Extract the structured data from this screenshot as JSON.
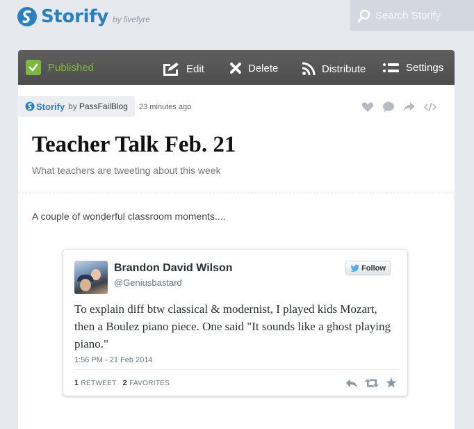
{
  "header": {
    "logo_text": "Storify",
    "logo_sub": "by livefyre",
    "search_placeholder": "Search Storify"
  },
  "toolbar": {
    "published_label": "Published",
    "edit_label": "Edit",
    "delete_label": "Delete",
    "distribute_label": "Distribute",
    "settings_label": "Settings"
  },
  "story": {
    "brand": "Storify",
    "by": "by",
    "author": "PassFailBlog",
    "time_ago": "23 minutes ago",
    "title": "Teacher Talk Feb. 21",
    "subtitle": "What teachers are tweeting about this week",
    "intro": "A couple of wonderful classroom moments...."
  },
  "tweet": {
    "name": "Brandon David Wilson",
    "handle": "@Geniusbastard",
    "follow_label": "Follow",
    "text": "To explain diff btw classical & modernist, I played kids Mozart, then a Boulez piano piece. One said \"It sounds like a ghost playing piano.\"",
    "date": "1:56 PM - 21 Feb 2014",
    "retweets": "1",
    "retweets_label": "RETWEET",
    "favorites": "2",
    "favorites_label": "FAVORITES"
  },
  "colors": {
    "brand": "#2a7fc1",
    "published": "#7cb93f",
    "toolbar": "#575757",
    "twitter": "#55acee"
  },
  "icons": {
    "toolbar": [
      "check-icon",
      "edit-icon",
      "close-icon",
      "rss-icon",
      "list-icon"
    ],
    "story_actions": [
      "heart-icon",
      "comment-icon",
      "share-icon",
      "embed-icon"
    ],
    "tweet_actions": [
      "reply-icon",
      "retweet-icon",
      "star-icon"
    ]
  }
}
